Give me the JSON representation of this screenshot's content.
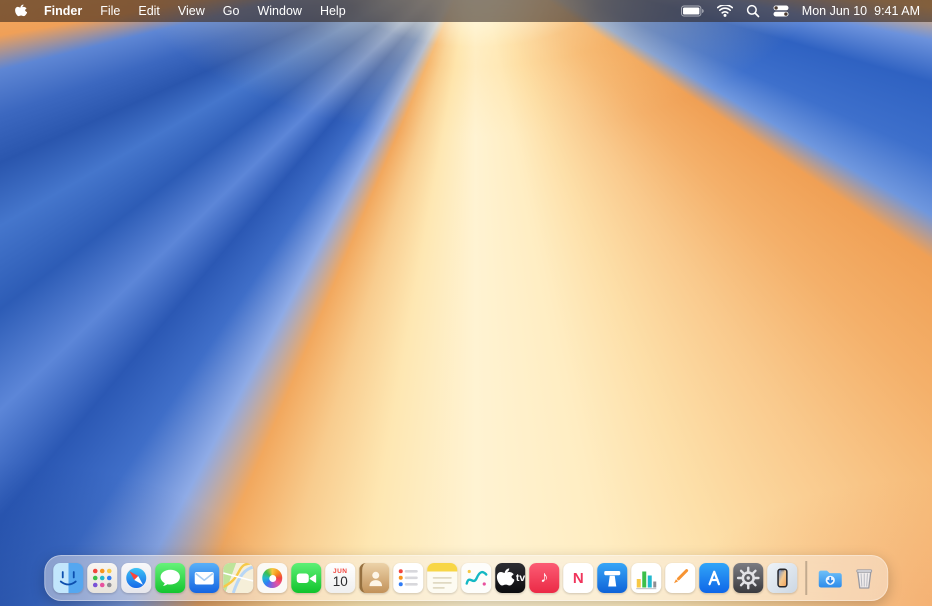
{
  "menubar": {
    "app_name": "Finder",
    "menus": [
      "File",
      "Edit",
      "View",
      "Go",
      "Window",
      "Help"
    ],
    "status_icons": [
      "battery-icon",
      "wifi-icon",
      "spotlight-search-icon",
      "control-center-icon"
    ],
    "date": "Mon Jun 10",
    "time": "9:41 AM"
  },
  "dock": {
    "apps": [
      "Finder",
      "Launchpad",
      "Safari",
      "Messages",
      "Mail",
      "Maps",
      "Photos",
      "FaceTime",
      "Calendar",
      "Contacts",
      "Reminders",
      "Notes",
      "Freeform",
      "TV",
      "Music",
      "News",
      "Keynote",
      "Numbers",
      "Pages",
      "App Store",
      "System Settings",
      "iPhone Mirroring",
      "Downloads",
      "Trash"
    ],
    "calendar_month": "JUN",
    "calendar_day": "10",
    "tv_label": "tv",
    "news_letter": "N",
    "music_note": "♪"
  },
  "colors": {
    "wallpaper_blue": "#2b58b4",
    "wallpaper_orange": "#f0a055",
    "wallpaper_cream": "#fff3d2",
    "menubar_text": "#ffffff"
  }
}
